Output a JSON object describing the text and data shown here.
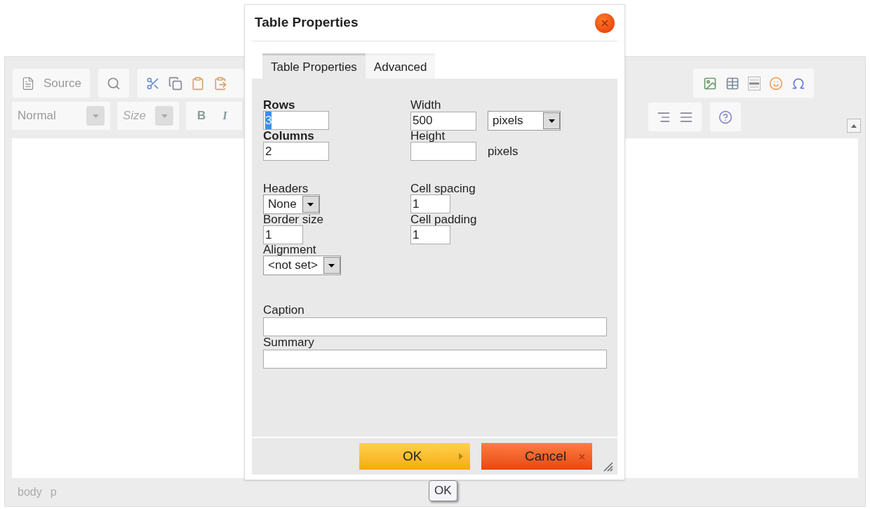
{
  "editor": {
    "toolbar": {
      "source_label": "Source",
      "format": "Normal",
      "size_placeholder": "Size",
      "bold": "B",
      "italic": "I"
    },
    "status_bar": [
      "body",
      "p"
    ]
  },
  "dialog": {
    "title": "Table Properties",
    "tabs": [
      {
        "label": "Table Properties",
        "selected": true
      },
      {
        "label": "Advanced",
        "selected": false
      }
    ],
    "size_fields": [
      [
        {
          "label": "Rows",
          "bold": true,
          "kind": "text",
          "value": "3",
          "text_selected": true
        },
        {
          "label": "Width",
          "bold": false,
          "kind": "text",
          "value": "500",
          "unit_dropdown": true,
          "unit": "pixels"
        }
      ],
      [
        {
          "label": "Columns",
          "bold": true,
          "kind": "text",
          "value": "2",
          "text_selected": false
        },
        {
          "label": "Height",
          "bold": false,
          "kind": "text",
          "unit_dropdown": false,
          "unit": "pixels"
        }
      ]
    ],
    "layout_fields": [
      [
        {
          "label": "Headers",
          "kind": "select",
          "value": "None"
        },
        {
          "label": "Cell spacing",
          "kind": "number",
          "value": "1"
        }
      ],
      [
        {
          "label": "Border size",
          "kind": "number",
          "value": "1"
        },
        {
          "label": "Cell padding",
          "kind": "number",
          "value": "1"
        }
      ],
      [
        {
          "label": "Alignment",
          "kind": "select",
          "value": "<not set>"
        }
      ]
    ],
    "text_fields": [
      {
        "label": "Caption"
      },
      {
        "label": "Summary"
      }
    ],
    "buttons": [
      {
        "label": "OK",
        "kind": "ok"
      },
      {
        "label": "Cancel",
        "kind": "cancel"
      }
    ]
  },
  "tooltip": "OK"
}
